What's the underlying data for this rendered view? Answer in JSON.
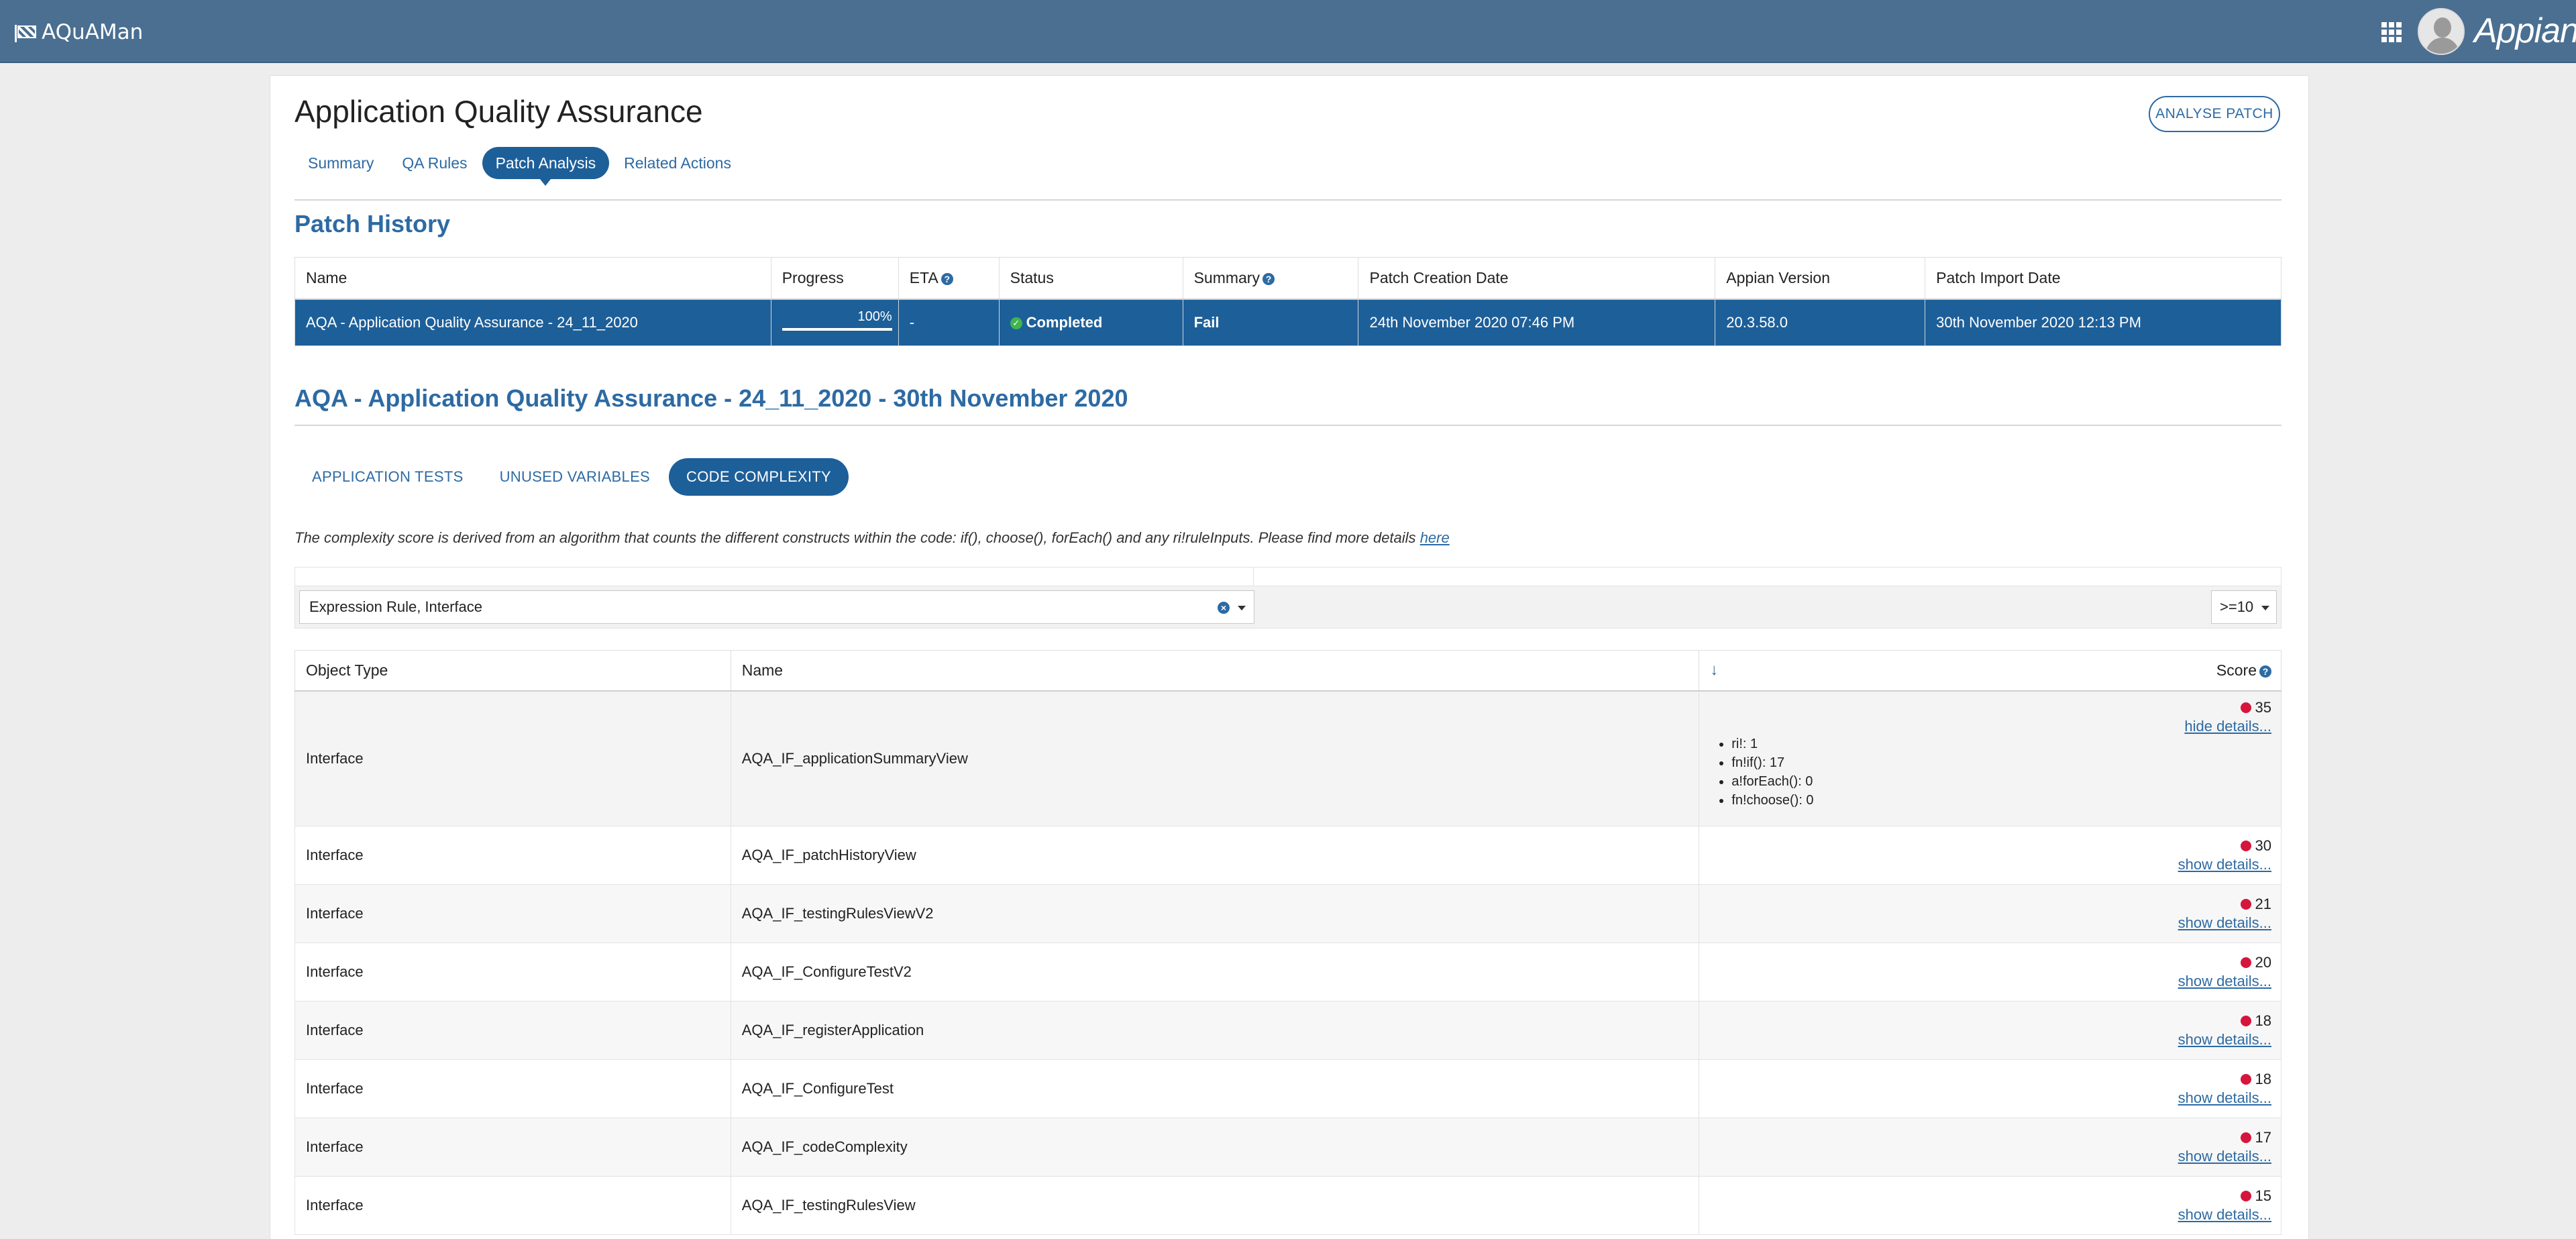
{
  "topbar": {
    "app_name": "AQuAMan",
    "brand": "Appian"
  },
  "page": {
    "title": "Application Quality Assurance",
    "analyse_button": "ANALYSE PATCH",
    "tabs": [
      {
        "label": "Summary"
      },
      {
        "label": "QA Rules"
      },
      {
        "label": "Patch Analysis",
        "active": true
      },
      {
        "label": "Related Actions"
      }
    ]
  },
  "patch_history": {
    "title": "Patch History",
    "headers": {
      "name": "Name",
      "progress": "Progress",
      "eta": "ETA",
      "status": "Status",
      "summary": "Summary",
      "creation_date": "Patch Creation Date",
      "appian_version": "Appian Version",
      "import_date": "Patch Import Date"
    },
    "row": {
      "name": "AQA - Application Quality Assurance - 24_11_2020",
      "progress_label": "100%",
      "progress_value": 1.0,
      "eta": "-",
      "status": "Completed",
      "summary": "Fail",
      "creation_date": "24th November 2020 07:46 PM",
      "appian_version": "20.3.58.0",
      "import_date": "30th November 2020 12:13 PM"
    }
  },
  "analysis": {
    "title": "AQA - Application Quality Assurance - 24_11_2020 - 30th November 2020",
    "subtabs": [
      {
        "label": "APPLICATION TESTS"
      },
      {
        "label": "UNUSED VARIABLES"
      },
      {
        "label": "CODE COMPLEXITY",
        "active": true
      }
    ],
    "description": "The complexity score is derived from an algorithm that counts the different constructs within the code: if(), choose(), forEach() and any ri!ruleInputs. Please find more details",
    "description_link": "here",
    "filter": {
      "type_value": "Expression Rule, Interface",
      "score_value": ">=10"
    },
    "table": {
      "headers": {
        "object_type": "Object Type",
        "name": "Name",
        "sort_icon": "↓",
        "score": "Score"
      },
      "rows": [
        {
          "object_type": "Interface",
          "name": "AQA_IF_applicationSummaryView",
          "score": "35",
          "link": "hide details...",
          "details": [
            "ri!: 1",
            "fn!if(): 17",
            "a!forEach(): 0",
            "fn!choose(): 0"
          ]
        },
        {
          "object_type": "Interface",
          "name": "AQA_IF_patchHistoryView",
          "score": "30",
          "link": "show details..."
        },
        {
          "object_type": "Interface",
          "name": "AQA_IF_testingRulesViewV2",
          "score": "21",
          "link": "show details..."
        },
        {
          "object_type": "Interface",
          "name": "AQA_IF_ConfigureTestV2",
          "score": "20",
          "link": "show details..."
        },
        {
          "object_type": "Interface",
          "name": "AQA_IF_registerApplication",
          "score": "18",
          "link": "show details..."
        },
        {
          "object_type": "Interface",
          "name": "AQA_IF_ConfigureTest",
          "score": "18",
          "link": "show details..."
        },
        {
          "object_type": "Interface",
          "name": "AQA_IF_codeComplexity",
          "score": "17",
          "link": "show details..."
        },
        {
          "object_type": "Interface",
          "name": "AQA_IF_testingRulesView",
          "score": "15",
          "link": "show details..."
        }
      ]
    }
  },
  "colors": {
    "topbar": "#4a6f91",
    "accent": "#1d5f99",
    "link": "#2d6aa3",
    "score_dot": "#d6153c",
    "completed": "#3fb54c"
  }
}
